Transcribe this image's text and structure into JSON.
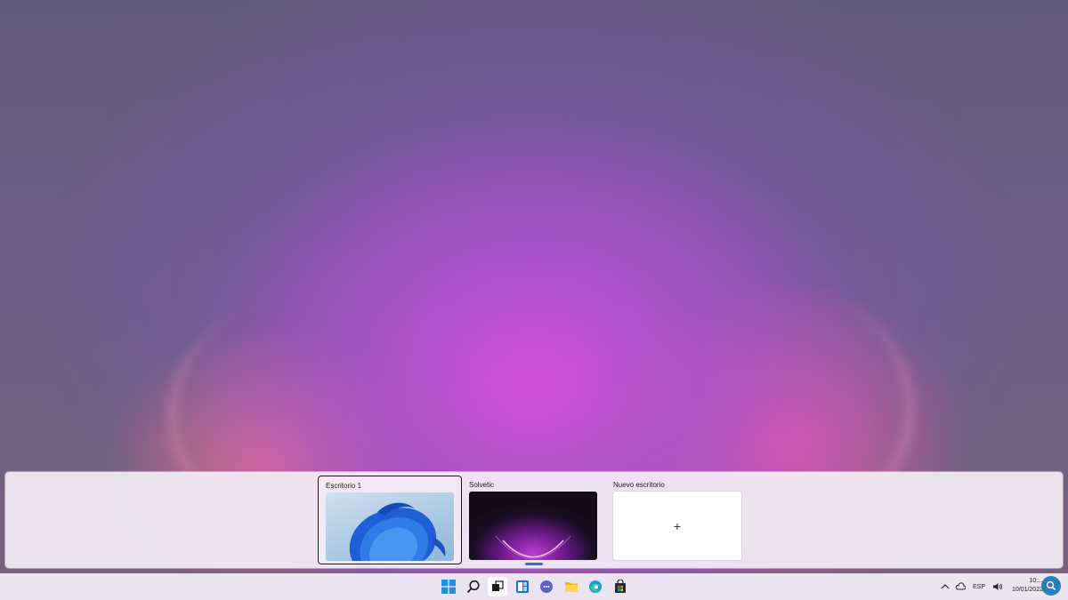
{
  "desktops": [
    {
      "label": "Escritorio 1",
      "state": "selected"
    },
    {
      "label": "Solvetic",
      "state": "current"
    },
    {
      "label": "Nuevo escritorio",
      "state": "new"
    }
  ],
  "new_desktop_symbol": "+",
  "taskbar": {
    "icons": [
      "windows-start-icon",
      "search-icon",
      "task-view-icon",
      "widgets-icon",
      "chat-icon",
      "file-explorer-icon",
      "edge-browser-icon",
      "store-icon"
    ]
  },
  "tray": {
    "language": "ESP",
    "time": "10:...",
    "date": "10/01/2022"
  },
  "colors": {
    "accent": "#2c6ec0",
    "windows_blue": "#1e90e8"
  }
}
